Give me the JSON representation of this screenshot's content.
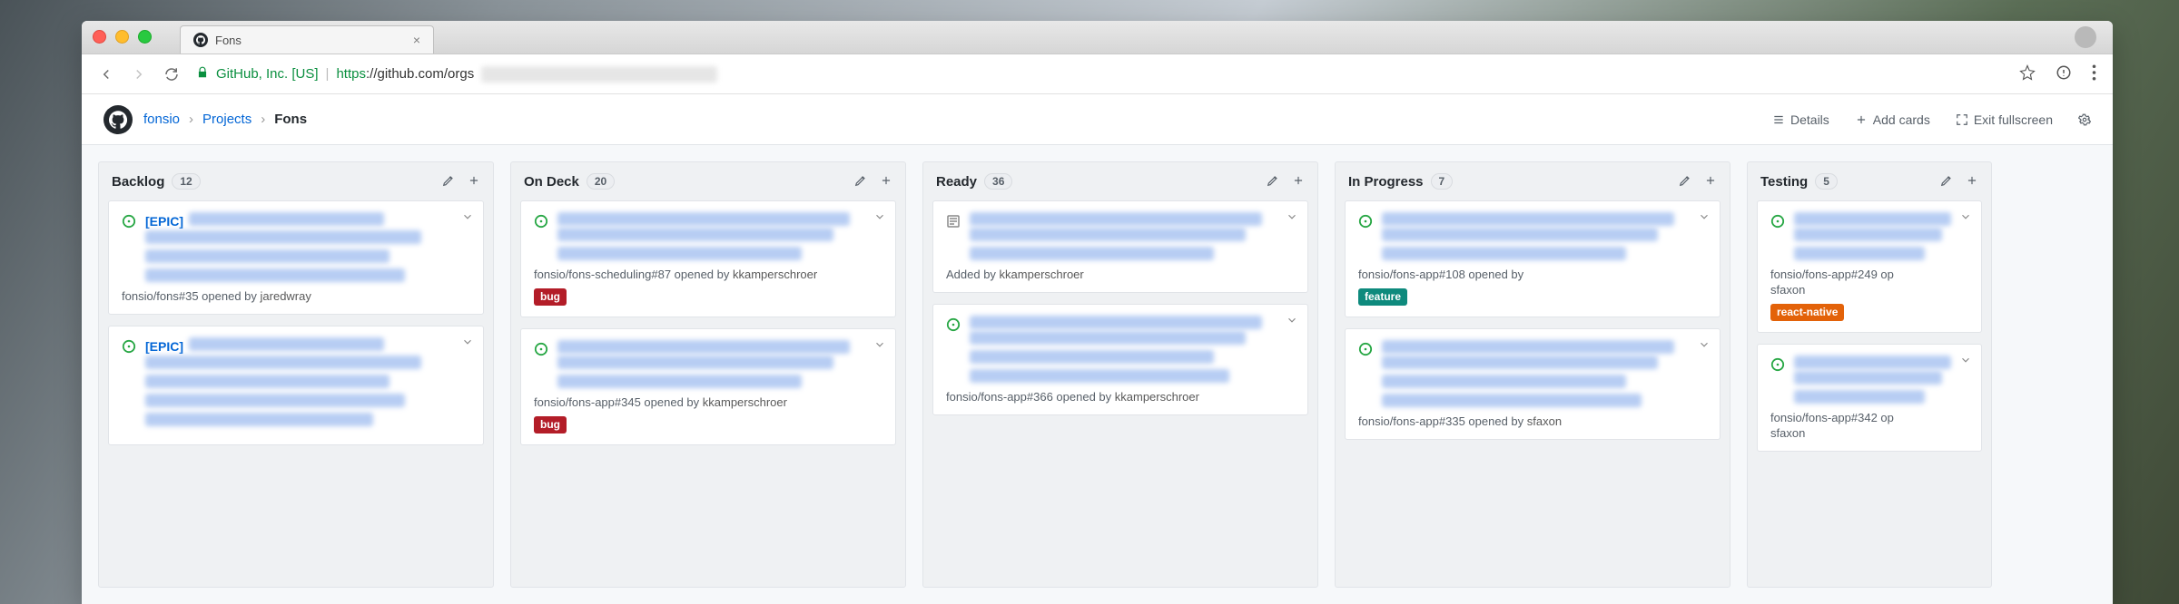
{
  "browser": {
    "tab_title": "Fons",
    "url_corp": "GitHub, Inc. [US]",
    "url_proto": "https",
    "url_host": "://github.com/orgs"
  },
  "header": {
    "crumbs": {
      "org": "fonsio",
      "projects": "Projects",
      "current": "Fons"
    },
    "actions": {
      "details": "Details",
      "add_cards": "Add cards",
      "exit_fullscreen": "Exit fullscreen"
    }
  },
  "columns": [
    {
      "title": "Backlog",
      "count": "12",
      "cards": [
        {
          "kind": "issue",
          "prefix": "[EPIC]",
          "meta_repo": "fonsio/fons#35",
          "meta_text": " opened by ",
          "meta_user": "jaredwray",
          "chevron": true,
          "title_lines": 4
        },
        {
          "kind": "issue",
          "prefix": "[EPIC]",
          "meta_repo": "",
          "meta_text": "",
          "meta_user": "",
          "chevron": true,
          "title_lines": 5
        }
      ]
    },
    {
      "title": "On Deck",
      "count": "20",
      "cards": [
        {
          "kind": "issue",
          "meta_repo": "fonsio/fons-scheduling#87",
          "meta_text": " opened by ",
          "meta_user": "kkamperschroer",
          "label": "bug",
          "chevron": true,
          "title_lines": 3
        },
        {
          "kind": "issue",
          "meta_repo": "fonsio/fons-app#345",
          "meta_text": " opened by ",
          "meta_user": "kkamperschroer",
          "label": "bug",
          "chevron": true,
          "title_lines": 3
        }
      ]
    },
    {
      "title": "Ready",
      "count": "36",
      "cards": [
        {
          "kind": "note",
          "added_by_label": "Added by ",
          "meta_user": "kkamperschroer",
          "chevron": true,
          "title_lines": 3
        },
        {
          "kind": "issue",
          "meta_repo": "fonsio/fons-app#366",
          "meta_text": " opened by ",
          "meta_user": "kkamperschroer",
          "chevron": true,
          "title_lines": 4
        }
      ]
    },
    {
      "title": "In Progress",
      "count": "7",
      "cards": [
        {
          "kind": "issue",
          "meta_repo": "fonsio/fons-app#108",
          "meta_text": " opened by",
          "meta_user": "",
          "label": "feature",
          "chevron": true,
          "title_lines": 3
        },
        {
          "kind": "issue",
          "meta_repo": "fonsio/fons-app#335",
          "meta_text": " opened by ",
          "meta_user": "sfaxon",
          "chevron": true,
          "title_lines": 4
        }
      ]
    },
    {
      "title": "Testing",
      "count": "5",
      "cards": [
        {
          "kind": "issue",
          "meta_repo": "fonsio/fons-app#249",
          "meta_text": " op",
          "meta_user2": "sfaxon",
          "label": "react-native",
          "chevron": true,
          "title_lines": 3
        },
        {
          "kind": "issue",
          "meta_repo": "fonsio/fons-app#342",
          "meta_text": " op",
          "meta_user2": "sfaxon",
          "chevron": true,
          "title_lines": 3
        }
      ]
    }
  ]
}
